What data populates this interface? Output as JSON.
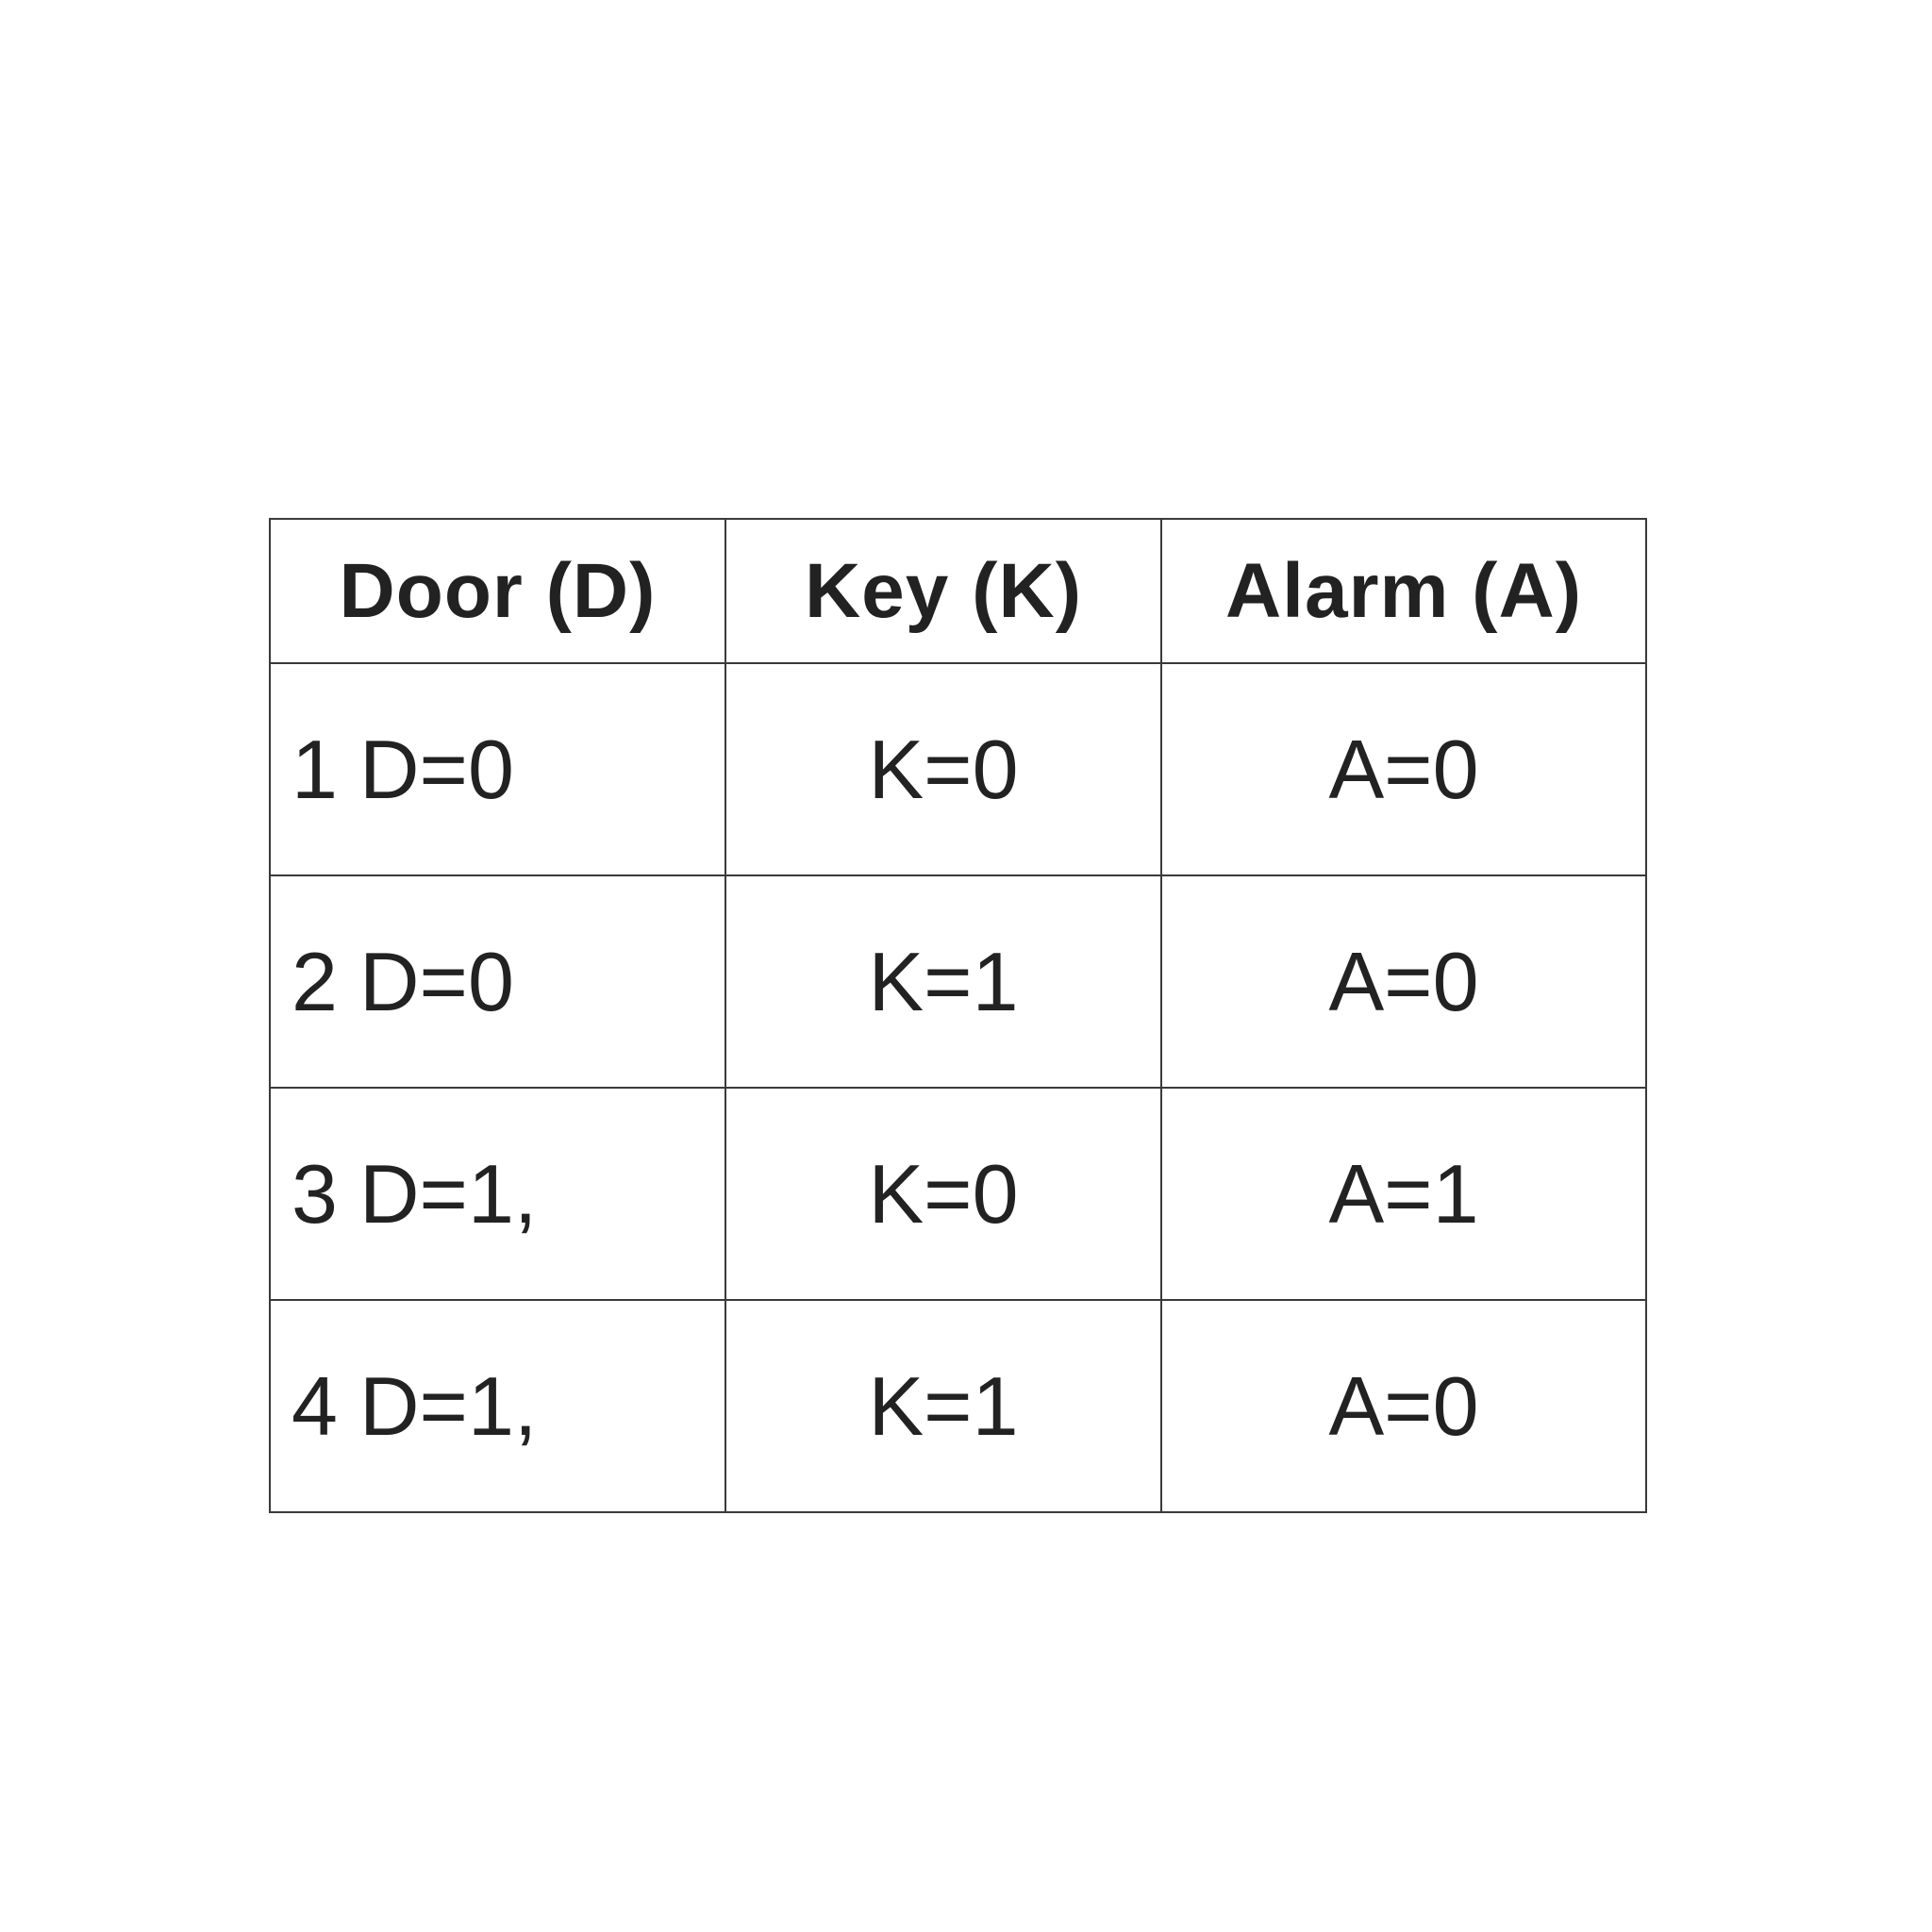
{
  "table": {
    "headers": [
      "Door (D)",
      "Key (K)",
      "Alarm (A)"
    ],
    "rows": [
      {
        "index": "1",
        "door": "D=0",
        "key": "K=0",
        "alarm": "A=0"
      },
      {
        "index": "2",
        "door": "D=0",
        "key": "K=1",
        "alarm": "A=0"
      },
      {
        "index": "3",
        "door": "D=1,",
        "key": "K=0",
        "alarm": "A=1"
      },
      {
        "index": "4",
        "door": "D=1,",
        "key": "K=1",
        "alarm": "A=0"
      }
    ]
  }
}
